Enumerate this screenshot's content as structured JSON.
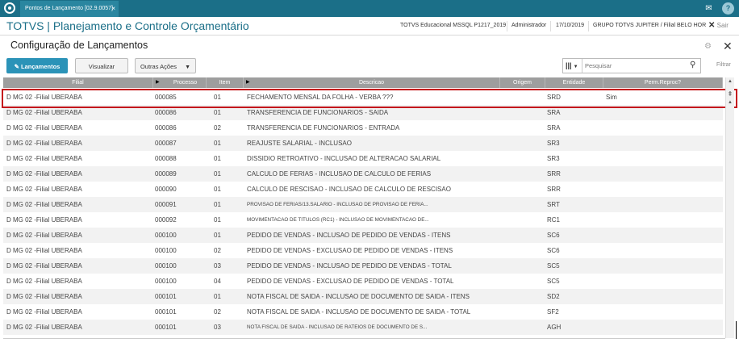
{
  "topbar": {
    "tab_label": "Pontos de Lançamento [02.9.0057]",
    "tab_close": "×",
    "mail_icon": "✉",
    "help_icon": "?"
  },
  "header": {
    "app_title": "TOTVS | Planejamento e Controle Orçamentário",
    "environment": "TOTVS Educacional MSSQL P1217_2019",
    "user": "Administrador",
    "date": "17/10/2019",
    "company": "GRUPO TOTVS JUPITER / Filial BELO HOR",
    "logout_label": "Sair",
    "logout_x": "✕"
  },
  "page": {
    "title": "Configuração de Lançamentos",
    "gear_icon": "⚙",
    "close_icon": "✕"
  },
  "toolbar": {
    "lancamentos": "Lançamentos",
    "visualizar": "Visualizar",
    "outras_acoes": "Outras Ações",
    "search_placeholder": "Pesquisar",
    "filtrar": "Filtrar"
  },
  "columns": [
    "Filial",
    "Processo",
    "Item",
    "Descricao",
    "Origem",
    "Entidade",
    "Perm.Reproc?"
  ],
  "rows": [
    {
      "filial": "D MG 02 -Filial UBERABA",
      "processo": "000085",
      "item": "01",
      "descricao": "FECHAMENTO MENSAL DA FOLHA - VERBA ???",
      "origem": "",
      "entidade": "SRD",
      "perm": "Sim",
      "small": false
    },
    {
      "filial": "D MG 02 -Filial UBERABA",
      "processo": "000086",
      "item": "01",
      "descricao": "TRANSFERENCIA DE FUNCIONARIOS - SAIDA",
      "origem": "",
      "entidade": "SRA",
      "perm": "",
      "small": false
    },
    {
      "filial": "D MG 02 -Filial UBERABA",
      "processo": "000086",
      "item": "02",
      "descricao": "TRANSFERENCIA DE FUNCIONARIOS - ENTRADA",
      "origem": "",
      "entidade": "SRA",
      "perm": "",
      "small": false
    },
    {
      "filial": "D MG 02 -Filial UBERABA",
      "processo": "000087",
      "item": "01",
      "descricao": "REAJUSTE SALARIAL - INCLUSAO",
      "origem": "",
      "entidade": "SR3",
      "perm": "",
      "small": false
    },
    {
      "filial": "D MG 02 -Filial UBERABA",
      "processo": "000088",
      "item": "01",
      "descricao": "DISSIDIO RETROATIVO - INCLUSAO DE ALTERACAO SALARIAL",
      "origem": "",
      "entidade": "SR3",
      "perm": "",
      "small": false
    },
    {
      "filial": "D MG 02 -Filial UBERABA",
      "processo": "000089",
      "item": "01",
      "descricao": "CALCULO DE FERIAS - INCLUSAO DE CALCULO DE FERIAS",
      "origem": "",
      "entidade": "SRR",
      "perm": "",
      "small": false
    },
    {
      "filial": "D MG 02 -Filial UBERABA",
      "processo": "000090",
      "item": "01",
      "descricao": "CALCULO DE RESCISAO - INCLUSAO DE CALCULO DE RESCISAO",
      "origem": "",
      "entidade": "SRR",
      "perm": "",
      "small": false
    },
    {
      "filial": "D MG 02 -Filial UBERABA",
      "processo": "000091",
      "item": "01",
      "descricao": "PROVISAO DE FERIAS/13.SALARIO - INCLUSAO DE PROVISAO DE FERIA...",
      "origem": "",
      "entidade": "SRT",
      "perm": "",
      "small": true
    },
    {
      "filial": "D MG 02 -Filial UBERABA",
      "processo": "000092",
      "item": "01",
      "descricao": "MOVIMENTACAO DE TITULOS (RC1) - INCLUSAO DE MOVIMENTACAO DE...",
      "origem": "",
      "entidade": "RC1",
      "perm": "",
      "small": true
    },
    {
      "filial": "D MG 02 -Filial UBERABA",
      "processo": "000100",
      "item": "01",
      "descricao": "PEDIDO DE VENDAS - INCLUSAO DE PEDIDO DE VENDAS - ITENS",
      "origem": "",
      "entidade": "SC6",
      "perm": "",
      "small": false
    },
    {
      "filial": "D MG 02 -Filial UBERABA",
      "processo": "000100",
      "item": "02",
      "descricao": "PEDIDO DE VENDAS - EXCLUSAO DE PEDIDO DE VENDAS - ITENS",
      "origem": "",
      "entidade": "SC6",
      "perm": "",
      "small": false
    },
    {
      "filial": "D MG 02 -Filial UBERABA",
      "processo": "000100",
      "item": "03",
      "descricao": "PEDIDO DE VENDAS - INCLUSAO DE PEDIDO DE VENDAS - TOTAL",
      "origem": "",
      "entidade": "SC5",
      "perm": "",
      "small": false
    },
    {
      "filial": "D MG 02 -Filial UBERABA",
      "processo": "000100",
      "item": "04",
      "descricao": "PEDIDO DE VENDAS - EXCLUSAO DE PEDIDO DE VENDAS - TOTAL",
      "origem": "",
      "entidade": "SC5",
      "perm": "",
      "small": false
    },
    {
      "filial": "D MG 02 -Filial UBERABA",
      "processo": "000101",
      "item": "01",
      "descricao": "NOTA FISCAL DE SAIDA - INCLUSAO DE DOCUMENTO DE SAIDA - ITENS",
      "origem": "",
      "entidade": "SD2",
      "perm": "",
      "small": false
    },
    {
      "filial": "D MG 02 -Filial UBERABA",
      "processo": "000101",
      "item": "02",
      "descricao": "NOTA FISCAL DE SAIDA - INCLUSAO DE DOCUMENTO DE SAIDA - TOTAL",
      "origem": "",
      "entidade": "SF2",
      "perm": "",
      "small": false
    },
    {
      "filial": "D MG 02 -Filial UBERABA",
      "processo": "000101",
      "item": "03",
      "descricao": "NOTA FISCAL DE SAIDA - INCLUSAO DE RATEIOS DE DOCUMENTO DE S...",
      "origem": "",
      "entidade": "AGH",
      "perm": "",
      "small": true
    }
  ]
}
